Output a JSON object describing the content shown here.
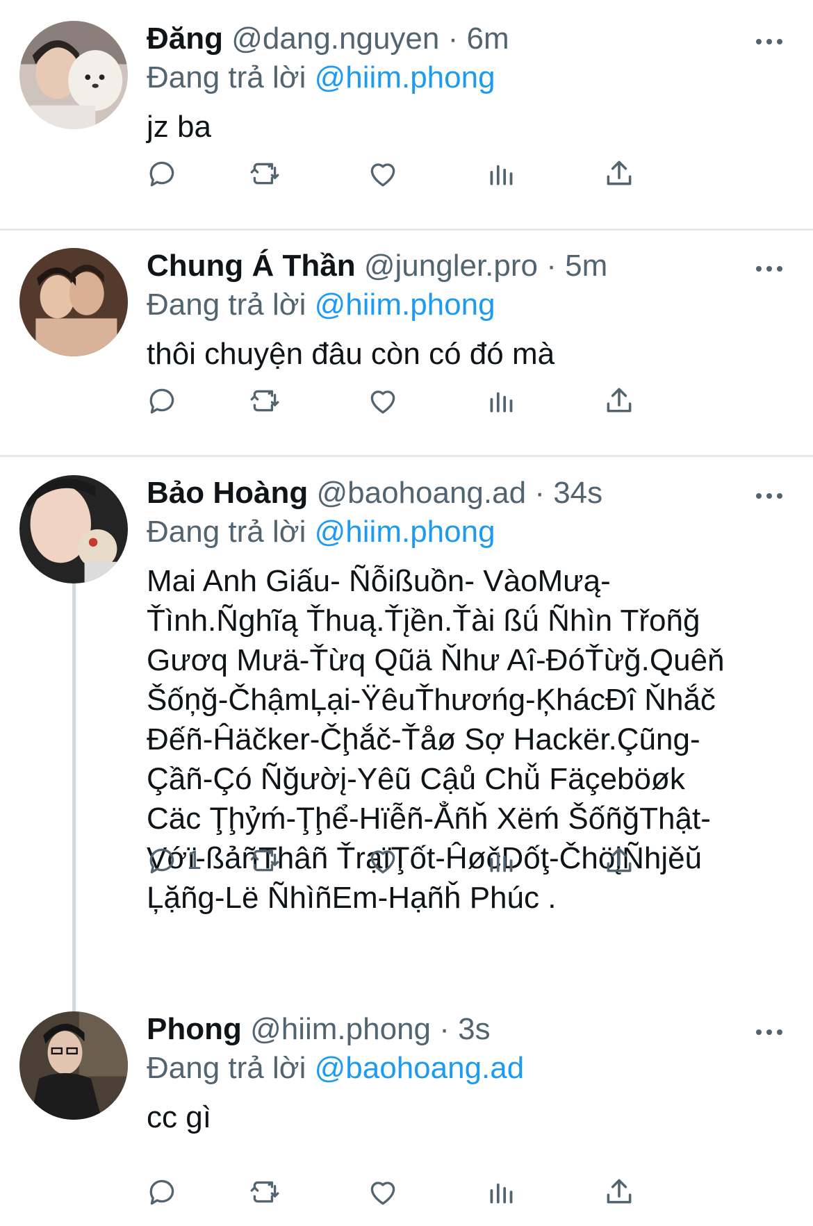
{
  "replying_label": "Đang trả lời",
  "tweets": [
    {
      "name": "Đăng",
      "handle": "@dang.nguyen",
      "sep": "·",
      "time": "6m",
      "reply_to": "@hiim.phong",
      "text": "jz ba",
      "reply_count": ""
    },
    {
      "name": "Chung Á Thần",
      "handle": "@jungler.pro",
      "sep": "·",
      "time": "5m",
      "reply_to": "@hiim.phong",
      "text": "thôi chuyện đâu còn có đó mà",
      "reply_count": ""
    },
    {
      "name": "Bảo Hoàng",
      "handle": "@baohoang.ad",
      "sep": "·",
      "time": "34s",
      "reply_to": "@hiim.phong",
      "text_lines": [
        "Mai Anh Giấu- Ñỗißuồn- VàoMưą-",
        "Ťình.Ñghĩą Ťhuą.Ťįền.Ťài ßǘ Ñhìn Třoñğ",
        "Gươq Mưä-Ťừq Qũä Ňhư Aî-ĐóŤừğ.Quêň",
        "Šốņğ-ČhậmĻại-ŸêuŤhươńg-ĶhácĐî Ňhắč",
        "Đếñ-Ĥäčker-Čḩắč-Ťåø Sợ Hackër.Çũng-",
        "Çầñ-Çó Ñğườį-Yêũ Cậů Chǚ Fäçeböøk",
        "Cäc Ţḩỷḿ-Ţḩể-Hïễñ-Ẳñȟ Xëḿ ŠốñğThật-",
        "Vớï-ßảñThâñ ŤrạïŢốt-ĤøčDốţ-ČhöįÑhjěŭ",
        "Ļặñg-Lë ÑhìñEm-Hạñȟ Phúc ."
      ],
      "reply_count": "1"
    },
    {
      "name": "Phong",
      "handle": "@hiim.phong",
      "sep": "·",
      "time": "3s",
      "reply_to": "@baohoang.ad",
      "text": "cc gì",
      "reply_count": ""
    }
  ],
  "icons": {
    "more": "more-dots-icon",
    "reply": "reply-bubble-icon",
    "retweet": "retweet-icon",
    "like": "heart-icon",
    "views": "bar-chart-icon",
    "share": "share-icon"
  },
  "colors": {
    "text": "#0f1419",
    "secondary": "#536471",
    "link": "#1d9bf0",
    "divider": "#e6e9ec",
    "thread_line": "#cfd9de"
  }
}
